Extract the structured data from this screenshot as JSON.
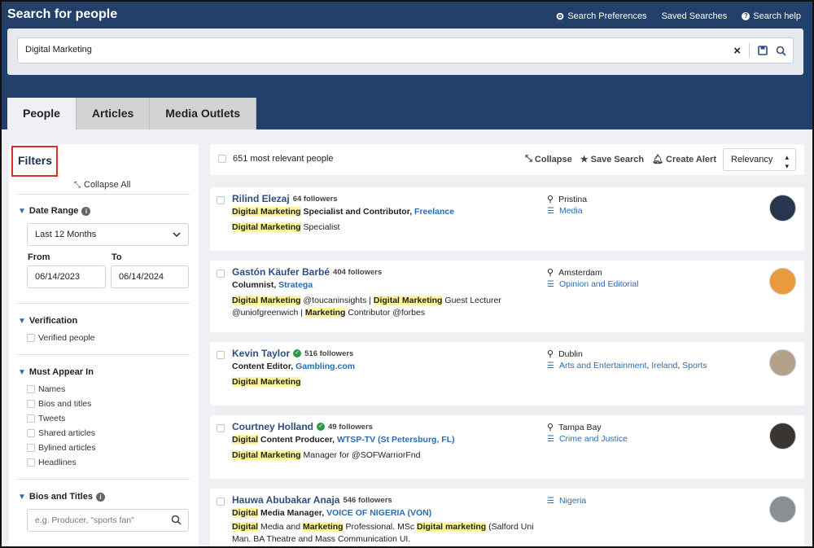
{
  "header": {
    "title": "Search for people",
    "links": [
      {
        "label": "Search Preferences",
        "icon": "gear-icon"
      },
      {
        "label": "Saved Searches",
        "icon": ""
      },
      {
        "label": "Search help",
        "icon": "help-icon"
      }
    ]
  },
  "search": {
    "value": "Digital Marketing",
    "placeholder": ""
  },
  "tabs": [
    {
      "label": "People",
      "active": true
    },
    {
      "label": "Articles",
      "active": false
    },
    {
      "label": "Media Outlets",
      "active": false
    }
  ],
  "sidebar": {
    "title": "Filters",
    "collapse_all": "Collapse All",
    "date_range": {
      "title": "Date Range",
      "selected": "Last 12 Months",
      "from_label": "From",
      "to_label": "To",
      "from": "06/14/2023",
      "to": "06/14/2024"
    },
    "verification": {
      "title": "Verification",
      "option": "Verified people"
    },
    "must_appear_in": {
      "title": "Must Appear In",
      "options": [
        "Names",
        "Bios and titles",
        "Tweets",
        "Shared articles",
        "Bylined articles",
        "Headlines"
      ]
    },
    "bios_titles": {
      "title": "Bios and Titles",
      "placeholder": "e.g. Producer, \"sports fan\""
    }
  },
  "results_bar": {
    "count": "651 most relevant people",
    "collapse": "Collapse",
    "save_search": "Save Search",
    "create_alert": "Create Alert",
    "sort": "Relevancy"
  },
  "people": [
    {
      "name": "Rilind Elezaj",
      "verified": false,
      "followers": "64 followers",
      "role": [
        {
          "t": "Digital Marketing",
          "hl": true
        },
        {
          "t": " Specialist and Contributor, ",
          "hl": false
        },
        {
          "t": "Freelance",
          "link": true
        }
      ],
      "bio": [
        {
          "t": "Digital Marketing",
          "hl": true
        },
        {
          "t": " Specialist",
          "hl": false
        }
      ],
      "location": "Pristina",
      "topics": [
        "Media"
      ],
      "avatar_color": "#2a3550"
    },
    {
      "name": "Gastón Käufer Barbé",
      "verified": false,
      "followers": "404 followers",
      "role": [
        {
          "t": "Columnist, ",
          "hl": false
        },
        {
          "t": "Stratega",
          "link": true
        }
      ],
      "bio": [
        {
          "t": "Digital Marketing",
          "hl": true
        },
        {
          "t": " @toucaninsights | ",
          "hl": false
        },
        {
          "t": "Digital Marketing",
          "hl": true
        },
        {
          "t": " Guest Lecturer @uniofgreenwich | ",
          "hl": false
        },
        {
          "t": "Marketing",
          "hl": true
        },
        {
          "t": " Contributor @forbes",
          "hl": false
        }
      ],
      "location": "Amsterdam",
      "topics": [
        "Opinion and Editorial"
      ],
      "avatar_color": "#e89a3c"
    },
    {
      "name": "Kevin Taylor",
      "verified": true,
      "followers": "516 followers",
      "role": [
        {
          "t": "Content Editor, ",
          "hl": false
        },
        {
          "t": "Gambling.com",
          "link": true
        }
      ],
      "bio": [
        {
          "t": "Digital Marketing",
          "hl": true
        }
      ],
      "location": "Dublin",
      "topics": [
        "Arts and Entertainment",
        "Ireland",
        "Sports"
      ],
      "avatar_color": "#b5a089"
    },
    {
      "name": "Courtney Holland",
      "verified": true,
      "followers": "49 followers",
      "role": [
        {
          "t": "Digital",
          "hl": true
        },
        {
          "t": " Content Producer, ",
          "hl": false
        },
        {
          "t": "WTSP-TV (St Petersburg, FL)",
          "link": true
        }
      ],
      "bio": [
        {
          "t": "Digital Marketing",
          "hl": true
        },
        {
          "t": " Manager for @SOFWarriorFnd",
          "hl": false
        }
      ],
      "location": "Tampa Bay",
      "topics": [
        "Crime and Justice"
      ],
      "avatar_color": "#3a3530"
    },
    {
      "name": "Hauwa Abubakar Anaja",
      "verified": false,
      "followers": "546 followers",
      "role": [
        {
          "t": "Digital",
          "hl": true
        },
        {
          "t": " Media Manager, ",
          "hl": false
        },
        {
          "t": "VOICE OF NIGERIA (VON)",
          "link": true
        }
      ],
      "bio": [
        {
          "t": "Digital",
          "hl": true
        },
        {
          "t": " Media and ",
          "hl": false
        },
        {
          "t": "Marketing",
          "hl": true
        },
        {
          "t": " Professional. MSc ",
          "hl": false
        },
        {
          "t": "Digital marketing",
          "hl": true
        },
        {
          "t": " (Salford Uni Man. BA Theatre and Mass Communication UI.",
          "hl": false
        }
      ],
      "location": "",
      "topics": [
        "Nigeria"
      ],
      "avatar_color": "#8a8f96"
    }
  ]
}
